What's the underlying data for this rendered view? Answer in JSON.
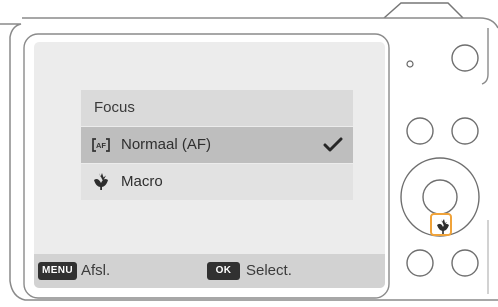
{
  "focus_menu": {
    "title": "Focus",
    "items": [
      {
        "label": "Normaal (AF)",
        "icon": "af-icon",
        "selected": true
      },
      {
        "label": "Macro",
        "icon": "macro-icon",
        "selected": false
      }
    ]
  },
  "footer": {
    "menu_key": "MENU",
    "menu_action": "Afsl.",
    "ok_key": "OK",
    "ok_action": "Select."
  },
  "colors": {
    "screen_background": "#ececec",
    "header_background": "#dadada",
    "selected_row": "#bebebe",
    "highlight_orange": "#f0a33a"
  }
}
